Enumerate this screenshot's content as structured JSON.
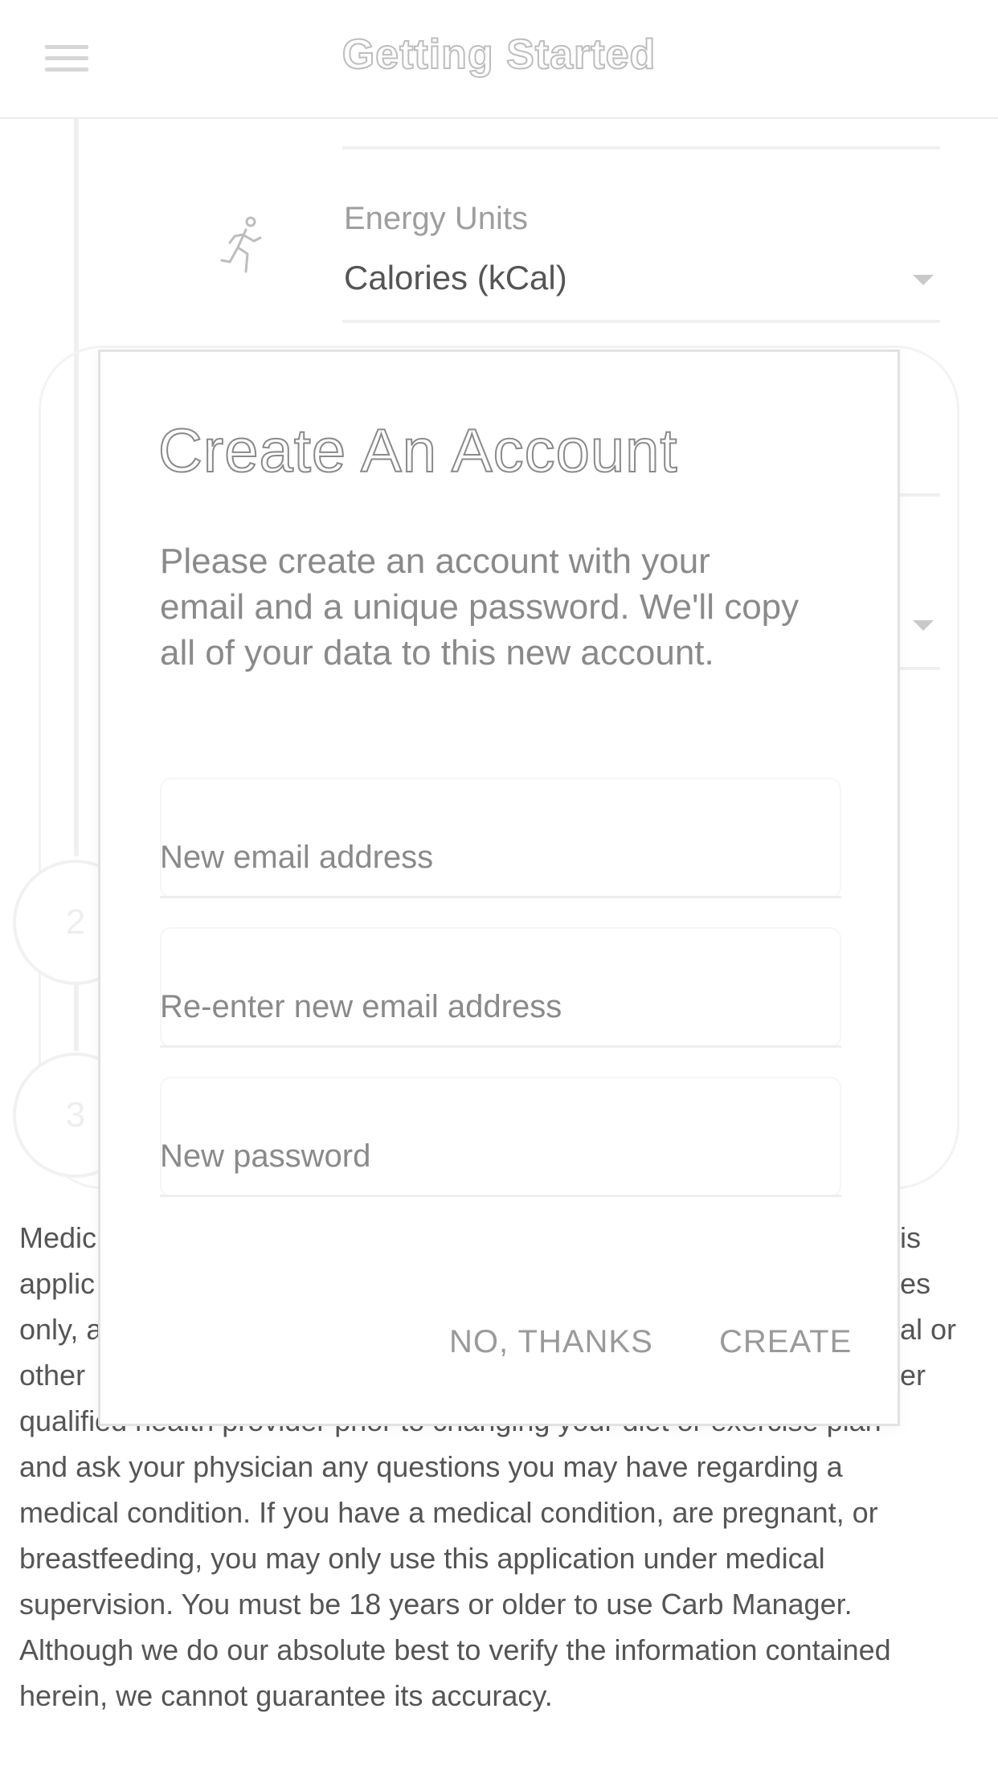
{
  "appbar": {
    "title": "Getting Started",
    "menu_icon": "hamburger-menu-icon"
  },
  "settings": {
    "energy_units": {
      "label": "Energy Units",
      "value": "Calories (kCal)",
      "icon": "running-person-icon"
    },
    "steps": [
      "2",
      "3"
    ]
  },
  "dialog": {
    "title": "Create An Account",
    "body": "Please create an account with your email and a unique password. We'll copy all of your data to this new account.",
    "fields": {
      "email_placeholder": "New email address",
      "reenter_email_placeholder": "Re-enter new email address",
      "password_placeholder": "New password"
    },
    "buttons": {
      "no_thanks": "NO, THANKS",
      "create": "CREATE"
    }
  },
  "disclaimer": {
    "line1_start": "Medic",
    "line1_end": "is",
    "line2_start": "applic",
    "line2_end": "es",
    "line3_start": "only, a",
    "line3_end": "al or",
    "line4_start": "other",
    "line4_end": "er",
    "line5": "qualified health provider prior to changing your diet or exercise plan",
    "line6": "and ask your physician any questions you may have regarding a",
    "line7": "medical condition. If you have a medical condition, are pregnant, or",
    "line8": "breastfeeding, you may only use this application under medical",
    "line9": "supervision. You must be 18 years or older to use Carb Manager.",
    "line10": "Although we do our absolute best to verify the information contained",
    "line11": "herein, we cannot guarantee its accuracy."
  },
  "colors": {
    "text": "#555555",
    "muted": "#9e9e9e",
    "dialog_border": "#e2e2e2"
  }
}
